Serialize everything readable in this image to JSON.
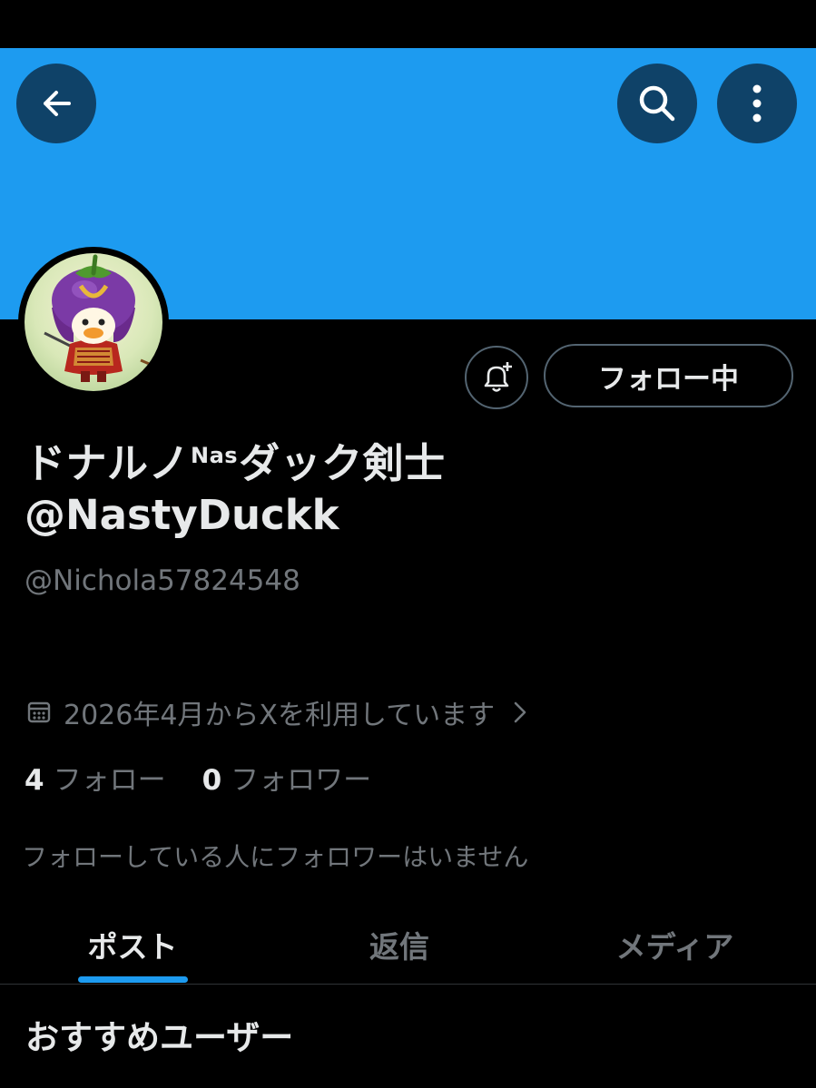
{
  "header": {
    "back_icon": "arrow-left-icon",
    "search_icon": "search-icon",
    "more_icon": "more-vertical-icon",
    "banner_color": "#1d9bf0",
    "button_bg": "#0f4268"
  },
  "profile": {
    "avatar_icon": "eggplant-duck-samurai-avatar",
    "name_part1": "ドナルノ",
    "name_superscript": "Nas",
    "name_part2": "ダック剣士",
    "name_line2": "@NastyDuckk",
    "handle": "@Nichola57824548",
    "joined": "2026年4月からXを利用しています",
    "following_count": "4",
    "following_label": "フォロー",
    "followers_count": "0",
    "followers_label": "フォロワー",
    "no_mutual_followers": "フォローしている人にフォロワーはいません"
  },
  "actions": {
    "notify_icon": "bell-plus-icon",
    "follow_button_label": "フォロー中"
  },
  "tabs": [
    {
      "label": "ポスト",
      "active": true
    },
    {
      "label": "返信",
      "active": false
    },
    {
      "label": "メディア",
      "active": false
    }
  ],
  "section": {
    "title": "おすすめユーザー"
  },
  "colors": {
    "accent": "#1d9bf0",
    "text_primary": "#e7e9ea",
    "text_secondary": "#71767b",
    "border": "#536471"
  }
}
